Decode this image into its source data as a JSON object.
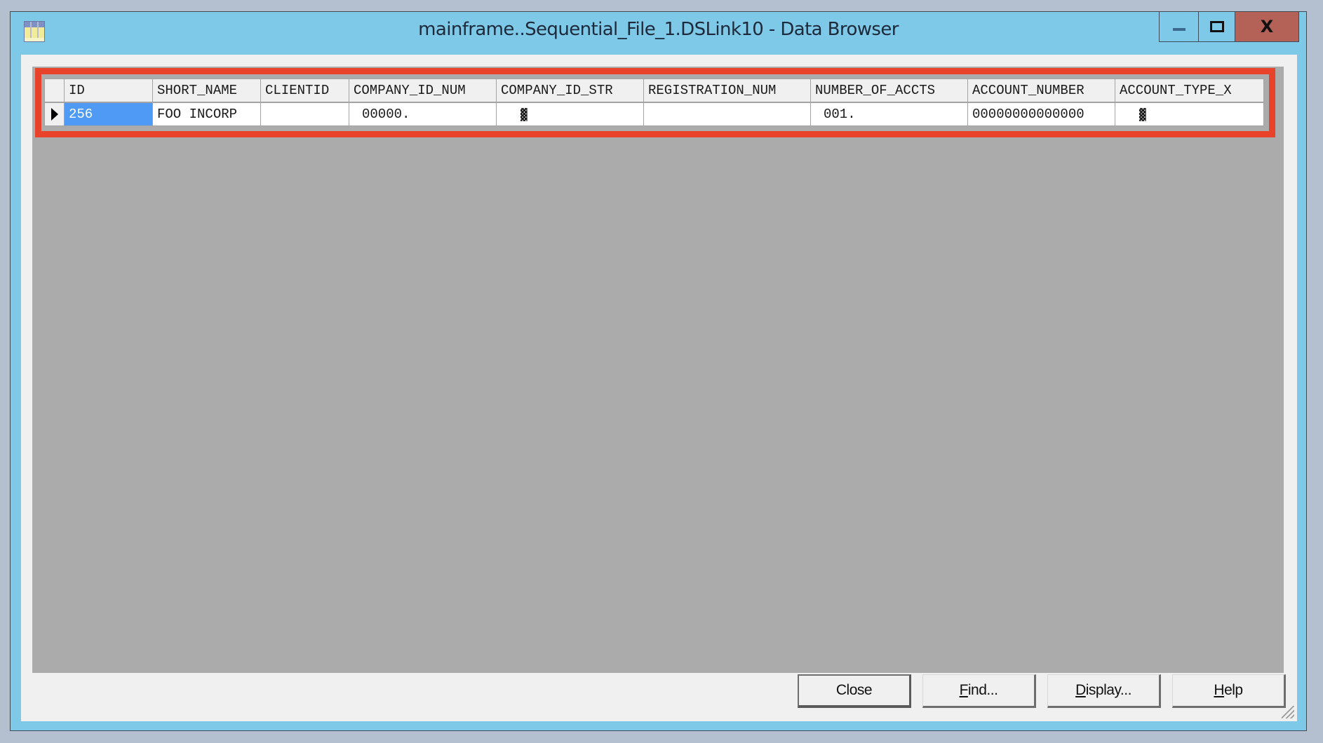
{
  "window": {
    "title": "mainframe..Sequential_File_1.DSLink10 - Data Browser",
    "icon": "data-grid-icon",
    "controls": {
      "minimize_icon": "minimize-icon",
      "maximize_icon": "maximize-icon",
      "close_icon": "close-icon",
      "close_glyph": "X"
    }
  },
  "grid": {
    "columns": [
      "ID",
      "SHORT_NAME",
      "CLIENTID",
      "COMPANY_ID_NUM",
      "COMPANY_ID_STR",
      "REGISTRATION_NUM",
      "NUMBER_OF_ACCTS",
      "ACCOUNT_NUMBER",
      "ACCOUNT_TYPE_X"
    ],
    "rows": [
      {
        "current": true,
        "cells": [
          "256",
          "FOO INCORP",
          "",
          "00000.",
          "▓",
          "",
          "001.",
          "00000000000000",
          "▓"
        ]
      }
    ],
    "selected_cell": {
      "row": 0,
      "column": "ID"
    },
    "highlight_color": "#e8432a",
    "selection_color": "#4f9af5"
  },
  "buttons": {
    "close": {
      "label": "Close",
      "mnemonic": ""
    },
    "find": {
      "mnemonic": "F",
      "rest": "ind..."
    },
    "display": {
      "mnemonic": "D",
      "rest": "isplay..."
    },
    "help": {
      "mnemonic": "H",
      "rest": "elp"
    }
  }
}
